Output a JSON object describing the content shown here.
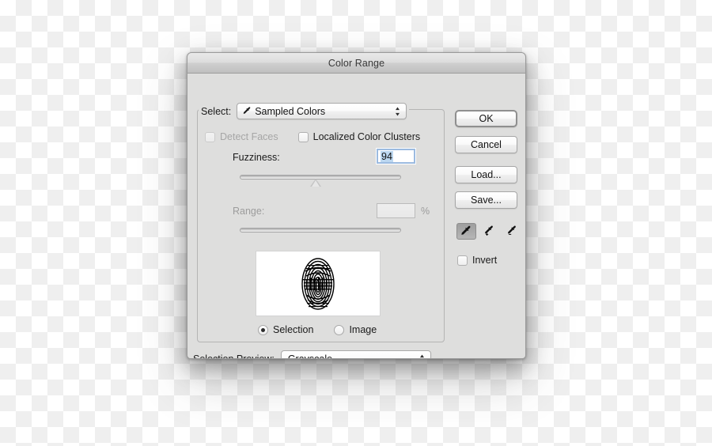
{
  "window": {
    "title": "Color Range"
  },
  "select_group": {
    "select_label": "Select:",
    "select_value": "Sampled Colors",
    "select_icon": "eyedropper-icon",
    "detect_faces_label": "Detect Faces",
    "detect_faces_checked": false,
    "detect_faces_enabled": false,
    "localized_label": "Localized Color Clusters",
    "localized_checked": false,
    "fuzziness_label": "Fuzziness:",
    "fuzziness_value": "94",
    "range_label": "Range:",
    "range_value": "",
    "range_percent": "%",
    "range_enabled": false
  },
  "preview": {
    "image_alt": "fingerprint-preview",
    "radio_selection_label": "Selection",
    "radio_image_label": "Image",
    "selected": "Selection"
  },
  "buttons": {
    "ok": "OK",
    "cancel": "Cancel",
    "load": "Load...",
    "save": "Save..."
  },
  "tools": {
    "eyedropper": "eyedropper-icon",
    "eyedropper_add": "eyedropper-plus-icon",
    "eyedropper_subtract": "eyedropper-minus-icon",
    "active_tool": "eyedropper-icon",
    "invert_label": "Invert",
    "invert_checked": false
  },
  "footer": {
    "selection_preview_label": "Selection Preview:",
    "selection_preview_value": "Grayscale"
  },
  "colors": {
    "dialog_bg": "#dededd",
    "field_focus": "#9cbbe0",
    "selection_highlight": "#bcd7f0",
    "text": "#1a1a1a",
    "disabled_text": "#9c9c9c"
  }
}
